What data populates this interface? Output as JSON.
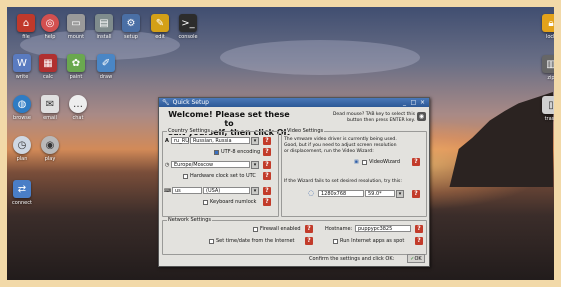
{
  "desktop": {
    "left_icons": [
      {
        "label": "file",
        "icon": "home-icon",
        "color": "#c0392b"
      },
      {
        "label": "help",
        "icon": "lifebuoy-icon",
        "color": "#d35050"
      },
      {
        "label": "mount",
        "icon": "drive-icon",
        "color": "#9a9a9a"
      },
      {
        "label": "install",
        "icon": "install-icon",
        "color": "#7f8c8d"
      },
      {
        "label": "setup",
        "icon": "setup-icon",
        "color": "#4a6fa5"
      },
      {
        "label": "edit",
        "icon": "pencil-icon",
        "color": "#d4a017"
      },
      {
        "label": "console",
        "icon": "terminal-icon",
        "color": "#2c2c2c"
      },
      {
        "label": "write",
        "icon": "write-icon",
        "color": "#5a7bc0"
      },
      {
        "label": "calc",
        "icon": "calc-icon",
        "color": "#b03030"
      },
      {
        "label": "paint",
        "icon": "paint-icon",
        "color": "#6aa84f"
      },
      {
        "label": "draw",
        "icon": "draw-icon",
        "color": "#4a86c5"
      },
      {
        "label": "browse",
        "icon": "globe-icon",
        "color": "#2f7cc4"
      },
      {
        "label": "email",
        "icon": "mail-icon",
        "color": "#e0e0e0"
      },
      {
        "label": "chat",
        "icon": "chat-icon",
        "color": "#eeeeee"
      },
      {
        "label": "plan",
        "icon": "clock-icon",
        "color": "#cfd8e3"
      },
      {
        "label": "play",
        "icon": "film-icon",
        "color": "#b9b9b9"
      },
      {
        "label": "connect",
        "icon": "network-icon",
        "color": "#4a7ec6"
      }
    ],
    "right_icons": [
      {
        "label": "lock",
        "icon": "lock-icon",
        "color": "#e3a21a"
      },
      {
        "label": "zip",
        "icon": "zip-icon",
        "color": "#666666"
      },
      {
        "label": "trash",
        "icon": "trash-icon",
        "color": "#d0d0d0"
      }
    ]
  },
  "dialog": {
    "title": "Quick Setup",
    "title_icon": "wrench-icon",
    "window_buttons": [
      "_",
      "□",
      "×"
    ],
    "welcome_line1": "Welcome! Please set these to",
    "welcome_line2": "suit yourself, then click OK",
    "dead_mouse_line1": "Dead mouse? TAB key to select this",
    "dead_mouse_line2": "button then press ENTER key.",
    "country": {
      "legend": "Country Settings",
      "locale_code": "ru_RU",
      "locale_name": "Russian, Russia",
      "utf8_label": "UTF-8 encoding",
      "timezone": "Europe/Moscow",
      "hwclock_label": "Hardware clock set to UTC",
      "keyboard": "us",
      "keyboard_name": "(USA)",
      "numlock_label": "Keyboard numlock"
    },
    "video": {
      "legend": "Video Settings",
      "text_line1": "The vmware video driver is currently being used.",
      "text_line2": "Good, but if you need to adjust screen resolution",
      "text_line3": "or displacement, run the Video Wizard:",
      "wizard_label": "VideoWizard",
      "fail_text": "If the Wizard fails to set desired resolution, try this:",
      "resolution": "1280x768",
      "refresh": "59.0*"
    },
    "network": {
      "legend": "Network Settings",
      "firewall_label": "Firewall enabled",
      "hostname_label": "Hostname:",
      "hostname_value": "puppypc3825",
      "time_label": "Set time/date from the Internet",
      "spot_label": "Run Internet apps as spot"
    },
    "confirm_text": "Confirm the settings and click OK:",
    "ok_label": "OK",
    "help_glyph": "?"
  }
}
